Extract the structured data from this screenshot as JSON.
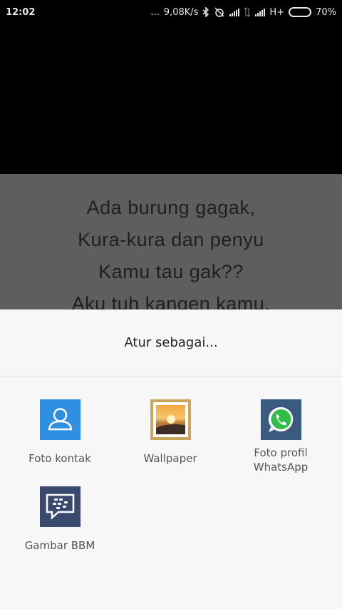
{
  "status_bar": {
    "time": "12:02",
    "dots": "...",
    "speed": "9,08K/s",
    "network_type": "H+",
    "battery": "70%",
    "battery_level": 0.7
  },
  "photo": {
    "lines": [
      "Ada burung gagak,",
      "Kura-kura dan penyu",
      "Kamu tau gak??",
      "Aku tuh kangen kamu."
    ]
  },
  "sheet": {
    "title": "Atur sebagai...",
    "options": [
      {
        "label": "Foto kontak",
        "icon": "contact-icon"
      },
      {
        "label": "Wallpaper",
        "icon": "wallpaper-icon"
      },
      {
        "label": "Foto profil\nWhatsApp",
        "icon": "whatsapp-icon"
      },
      {
        "label": "Gambar BBM",
        "icon": "bbm-icon"
      }
    ]
  },
  "colors": {
    "contact": "#2f8fe0",
    "wallpaper_frame": "#caa55a",
    "whatsapp_bg": "#3b5a7f",
    "bbm_bg": "#3a4a6e"
  }
}
